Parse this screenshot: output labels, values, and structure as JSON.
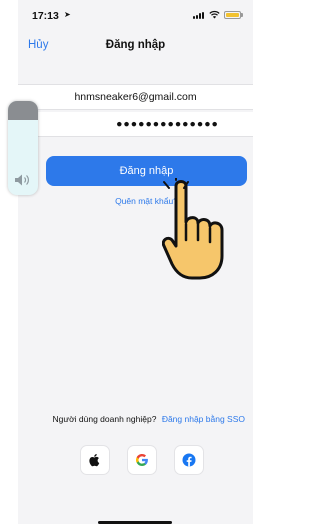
{
  "status": {
    "time": "17:13"
  },
  "nav": {
    "cancel": "Hủy",
    "title": "Đăng nhập"
  },
  "form": {
    "email": "hnmsneaker6@gmail.com",
    "password": "●●●●●●●●●●●●●●"
  },
  "login_button": "Đăng nhập",
  "forgot_link": "Quên mật khẩu?",
  "sso": {
    "question": "Người dùng doanh nghiệp?",
    "link": "Đăng nhập bằng SSO"
  },
  "social_icons": [
    "apple-icon",
    "google-icon",
    "facebook-icon"
  ],
  "colors": {
    "accent": "#2d79ea",
    "background": "#f4f4f6",
    "battery": "#f2c230"
  },
  "volume_level": 0.8
}
